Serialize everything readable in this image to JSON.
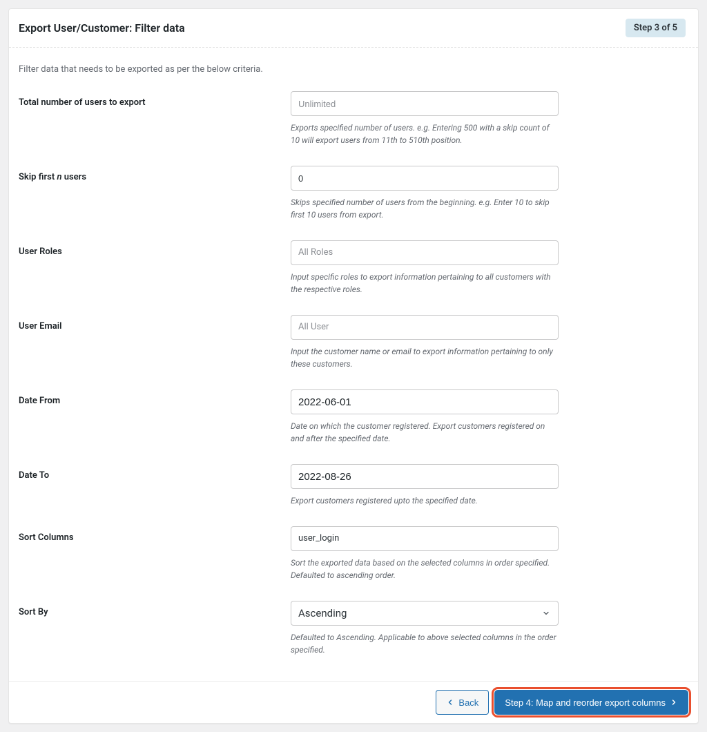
{
  "header": {
    "title": "Export User/Customer: Filter data",
    "step_badge": "Step 3 of 5"
  },
  "description": "Filter data that needs to be exported as per the below criteria.",
  "fields": {
    "total": {
      "label": "Total number of users to export",
      "placeholder": "Unlimited",
      "value": "",
      "help": "Exports specified number of users. e.g. Entering 500 with a skip count of 10 will export users from 11th to 510th position."
    },
    "skip": {
      "label_pre": "Skip first ",
      "label_em": "n",
      "label_post": " users",
      "value": "0",
      "help": "Skips specified number of users from the beginning. e.g. Enter 10 to skip first 10 users from export."
    },
    "roles": {
      "label": "User Roles",
      "placeholder": "All Roles",
      "value": "",
      "help": "Input specific roles to export information pertaining to all customers with the respective roles."
    },
    "email": {
      "label": "User Email",
      "placeholder": "All User",
      "value": "",
      "help": "Input the customer name or email to export information pertaining to only these customers."
    },
    "date_from": {
      "label": "Date From",
      "value": "2022-06-01",
      "help": "Date on which the customer registered. Export customers registered on and after the specified date."
    },
    "date_to": {
      "label": "Date To",
      "value": "2022-08-26",
      "help": "Export customers registered upto the specified date."
    },
    "sort_columns": {
      "label": "Sort Columns",
      "value": "user_login",
      "help": "Sort the exported data based on the selected columns in order specified. Defaulted to ascending order."
    },
    "sort_by": {
      "label": "Sort By",
      "value": "Ascending",
      "help": "Defaulted to Ascending. Applicable to above selected columns in the order specified."
    }
  },
  "footer": {
    "back_label": "Back",
    "next_label": "Step 4: Map and reorder export columns"
  }
}
